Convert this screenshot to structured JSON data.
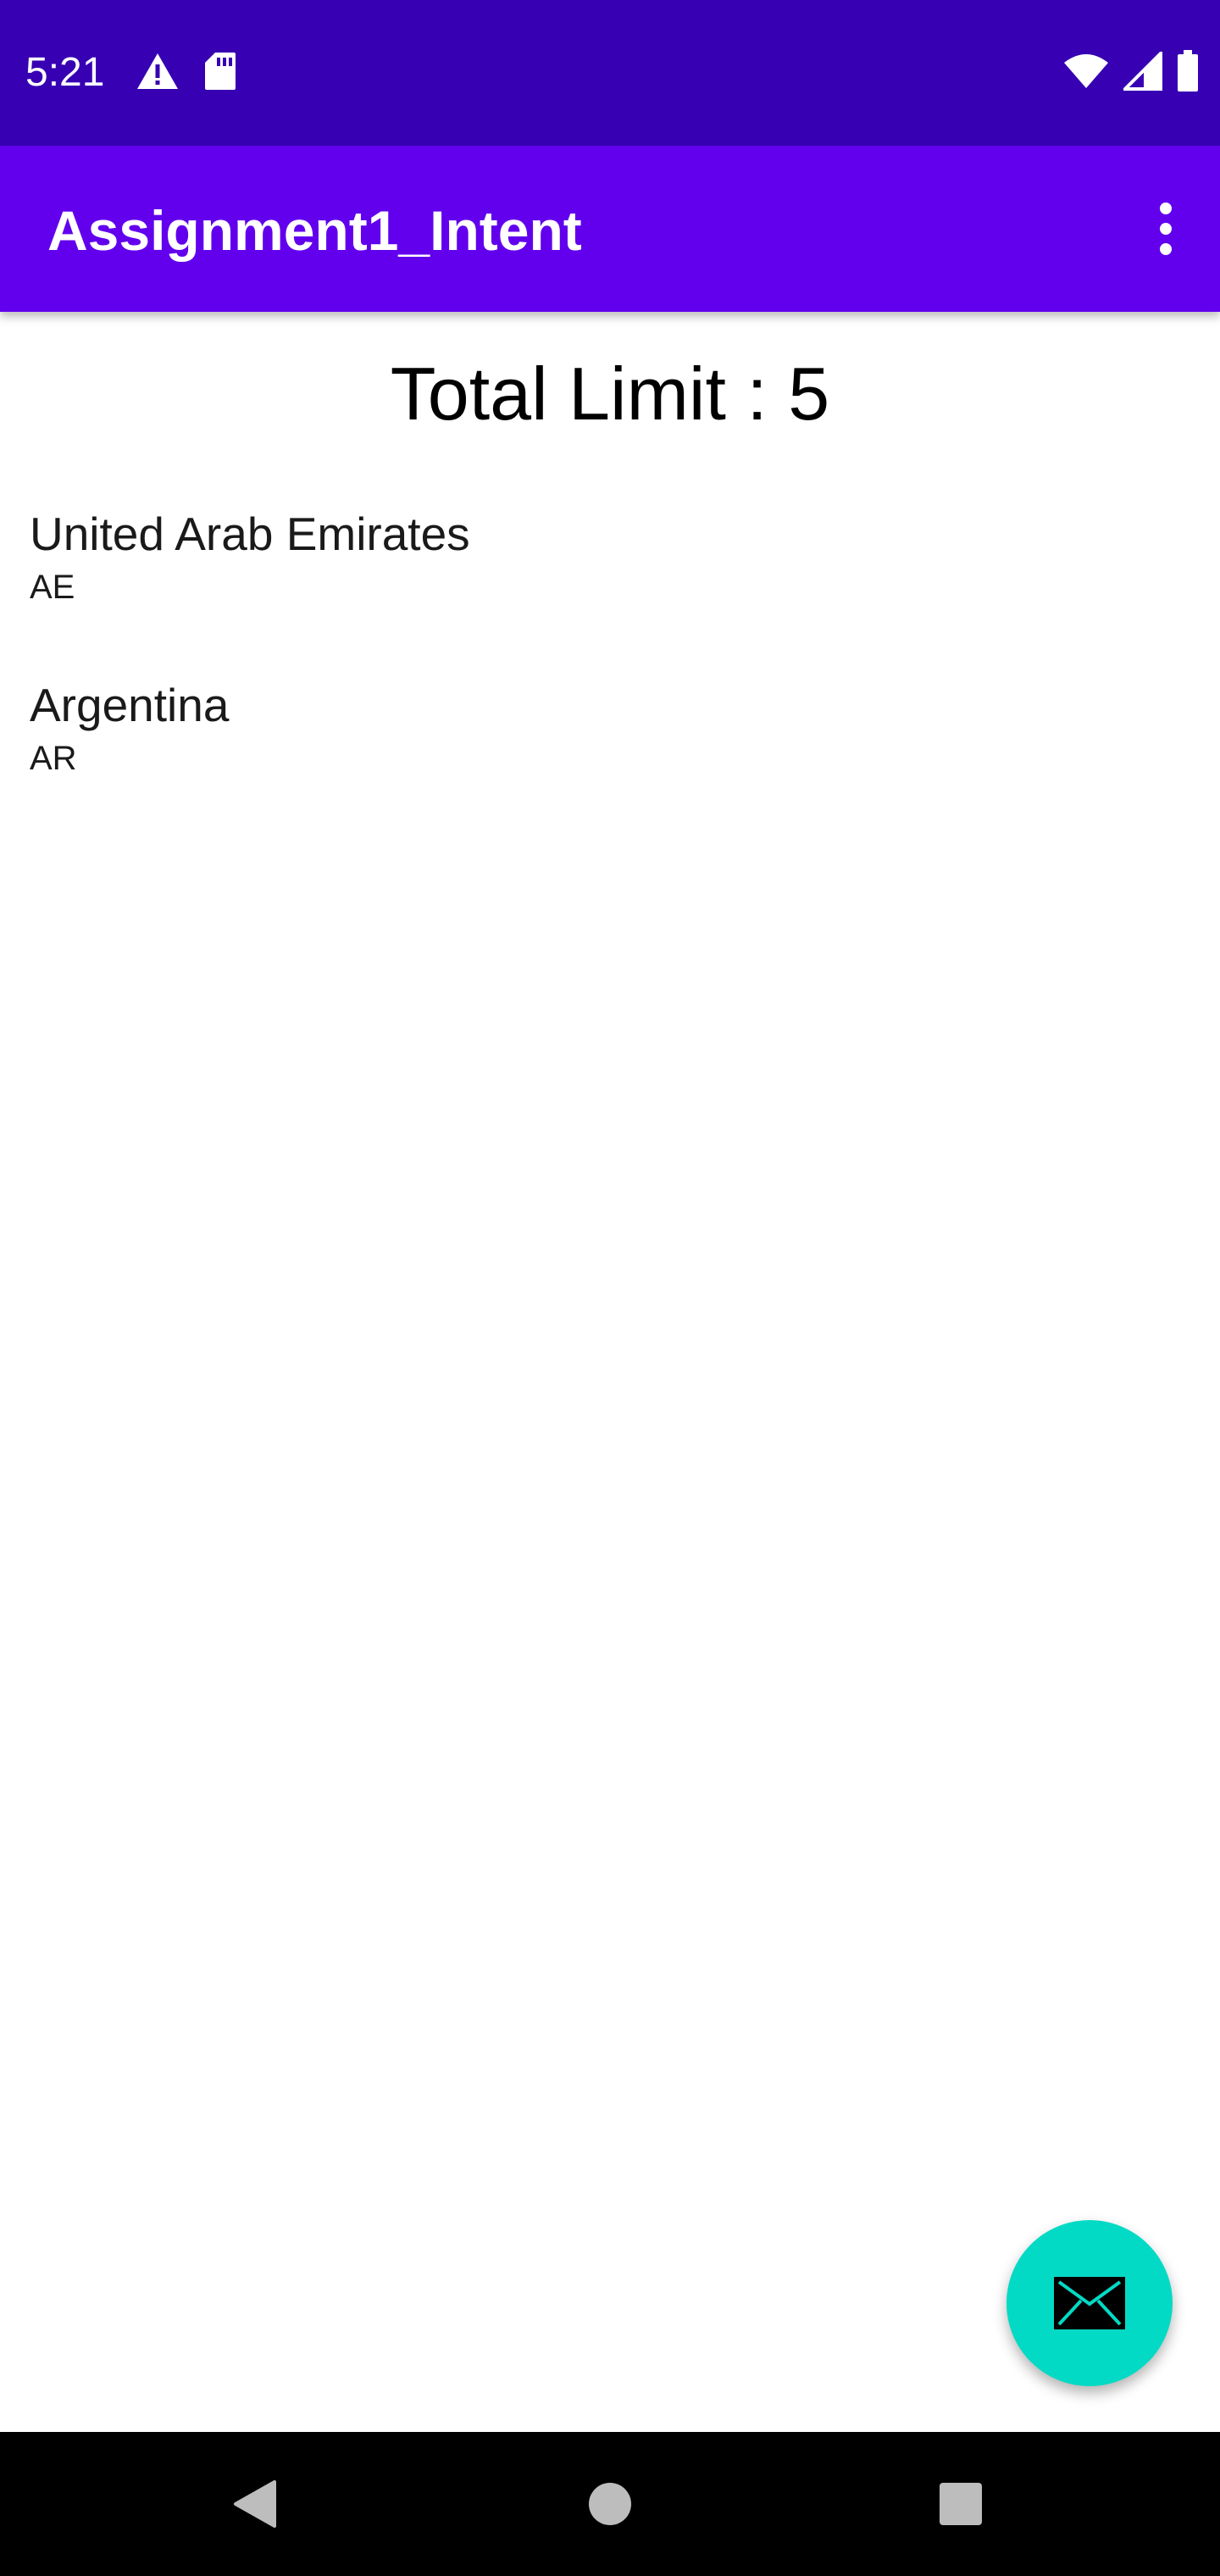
{
  "status_bar": {
    "time": "5:21",
    "icons_left": [
      "warning-icon",
      "sd-card-icon"
    ],
    "icons_right": [
      "wifi-icon",
      "cell-signal-icon",
      "battery-icon"
    ],
    "background": "#3700b3"
  },
  "app_bar": {
    "title": "Assignment1_Intent",
    "background": "#6200ee",
    "overflow_icon": "more-vert-icon"
  },
  "content": {
    "total_limit": "Total Limit : 5",
    "countries": [
      {
        "name": "United Arab Emirates",
        "code": "AE"
      },
      {
        "name": "Argentina",
        "code": "AR"
      }
    ]
  },
  "fab": {
    "icon": "mail-icon",
    "color": "#03dac5"
  },
  "nav_bar": {
    "buttons": [
      "back-icon",
      "home-icon",
      "recents-icon"
    ],
    "background": "#000000"
  }
}
